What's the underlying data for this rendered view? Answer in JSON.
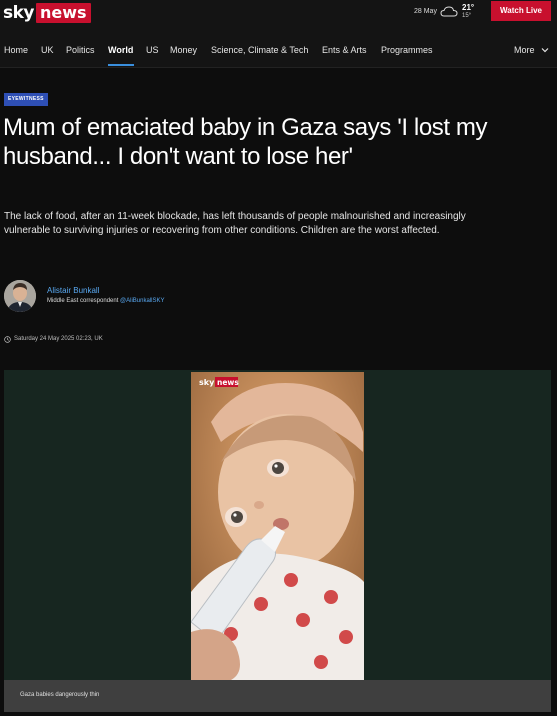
{
  "header": {
    "logo_sky": "sky",
    "logo_news": "news",
    "date": "28 May",
    "weather_icon": "cloud-icon",
    "temp_high": "21°",
    "temp_low": "15°",
    "watch_live": "Watch Live",
    "brand_color": "#c8102e"
  },
  "nav": {
    "items": [
      "Home",
      "UK",
      "Politics",
      "World",
      "US",
      "Money",
      "Science, Climate & Tech",
      "Ents & Arts",
      "Programmes"
    ],
    "active": "World",
    "more": "More",
    "accent": "#3a8fdd"
  },
  "article": {
    "badge": "EYEWITNESS",
    "headline": "Mum of emaciated baby in Gaza says 'I lost my husband... I don't want to lose her'",
    "standfirst": "The lack of food, after an 11-week blockade, has left thousands of people malnourished and increasingly vulnerable to surviving injuries or recovering from other conditions. Children are the worst affected.",
    "author": {
      "name": "Alistair Bunkall",
      "role": "Middle East correspondent",
      "handle": "@AliBunkallSKY"
    },
    "timestamp": "Saturday 24 May 2025 02:23, UK"
  },
  "video": {
    "watermark_sky": "sky",
    "watermark_news": "news",
    "caption": "Gaza babies dangerously thin"
  }
}
